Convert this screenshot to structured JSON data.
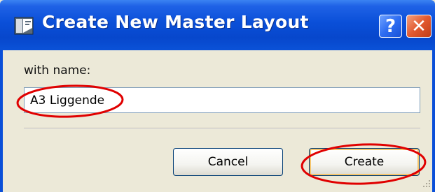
{
  "window": {
    "title": "Create New Master Layout",
    "help_symbol": "?",
    "close_symbol": "✕",
    "title_icon": "layout-app-icon"
  },
  "form": {
    "name_label": "with name:",
    "name_value": "A3 Liggende"
  },
  "buttons": {
    "cancel_label": "Cancel",
    "create_label": "Create"
  },
  "colors": {
    "titlebar": "#0a4fd8",
    "dialog_bg": "#ece9d8",
    "annotation": "#e00000"
  }
}
